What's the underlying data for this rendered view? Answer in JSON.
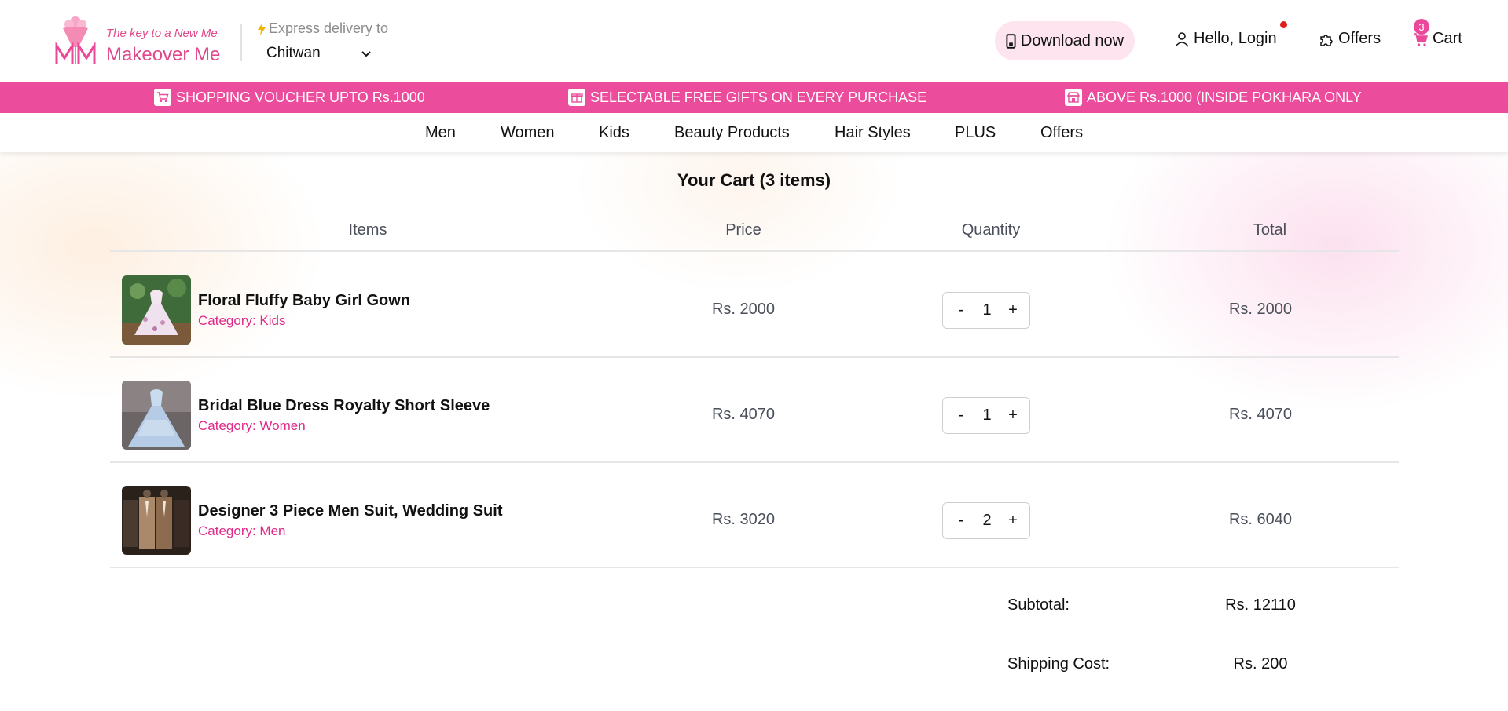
{
  "header": {
    "tagline": "The key to a New Me",
    "brand": "Makeover Me",
    "express_label": "Express delivery to",
    "location": "Chitwan",
    "download_label": "Download now",
    "login_label": "Hello, Login",
    "offers_label": "Offers",
    "cart_label": "Cart",
    "cart_count": "3",
    "accent_color": "#ec4899"
  },
  "promo": [
    {
      "text": "SHOPPING VOUCHER UPTO Rs.1000",
      "icon": "cart-icon"
    },
    {
      "text": "SELECTABLE FREE GIFTS ON EVERY PURCHASE",
      "icon": "gift-icon"
    },
    {
      "text": "ABOVE Rs.1000 (INSIDE POKHARA ONLY",
      "icon": "store-icon"
    }
  ],
  "nav": [
    "Men",
    "Women",
    "Kids",
    "Beauty Products",
    "Hair Styles",
    "PLUS",
    "Offers"
  ],
  "cart": {
    "title": "Your Cart (3 items)",
    "columns": [
      "Items",
      "Price",
      "Quantity",
      "Total"
    ],
    "items": [
      {
        "name": "Floral Fluffy Baby Girl Gown",
        "category": "Category: Kids",
        "price": "Rs. 2000",
        "qty": "1",
        "total": "Rs. 2000"
      },
      {
        "name": "Bridal Blue Dress Royalty Short Sleeve",
        "category": "Category: Women",
        "price": "Rs. 4070",
        "qty": "1",
        "total": "Rs. 4070"
      },
      {
        "name": "Designer 3 Piece Men Suit, Wedding Suit",
        "category": "Category: Men",
        "price": "Rs. 3020",
        "qty": "2",
        "total": "Rs. 6040"
      }
    ],
    "qty_minus": "-",
    "qty_plus": "+"
  },
  "summary": {
    "subtotal_label": "Subtotal:",
    "subtotal": "Rs. 12110",
    "shipping_label": "Shipping Cost:",
    "shipping": "Rs. 200"
  }
}
